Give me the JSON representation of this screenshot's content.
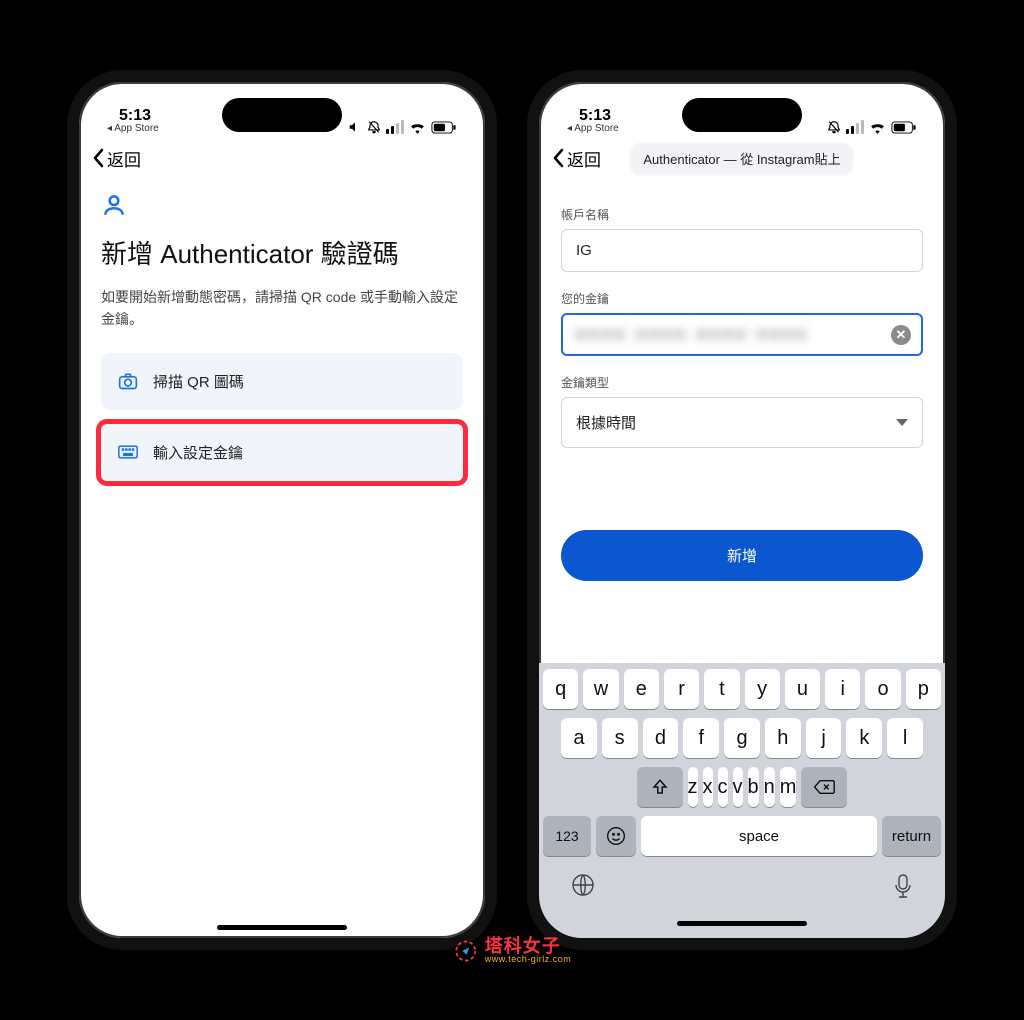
{
  "statusbar": {
    "time": "5:13",
    "back_app": "App Store"
  },
  "left": {
    "nav_back": "返回",
    "title": "新增 Authenticator 驗證碼",
    "description": "如要開始新增動態密碼，請掃描 QR code 或手動輸入設定金鑰。",
    "option_scan": "掃描 QR 圖碼",
    "option_key": "輸入設定金鑰"
  },
  "right": {
    "nav_back": "返回",
    "nav_title": "Authenticator — 從 Instagram貼上",
    "label_account": "帳戶名稱",
    "value_account": "IG",
    "label_key": "您的金鑰",
    "value_key": "■■■■ ■■■■ ■■■■ ■■■■",
    "label_type": "金鑰類型",
    "value_type": "根據時間",
    "btn_add": "新增"
  },
  "keyboard": {
    "row1": [
      "q",
      "w",
      "e",
      "r",
      "t",
      "y",
      "u",
      "i",
      "o",
      "p"
    ],
    "row2": [
      "a",
      "s",
      "d",
      "f",
      "g",
      "h",
      "j",
      "k",
      "l"
    ],
    "row3": [
      "z",
      "x",
      "c",
      "v",
      "b",
      "n",
      "m"
    ],
    "key_123": "123",
    "key_space": "space",
    "key_return": "return"
  },
  "watermark": {
    "brand": "塔科女子",
    "url": "www.tech-girlz.com"
  }
}
